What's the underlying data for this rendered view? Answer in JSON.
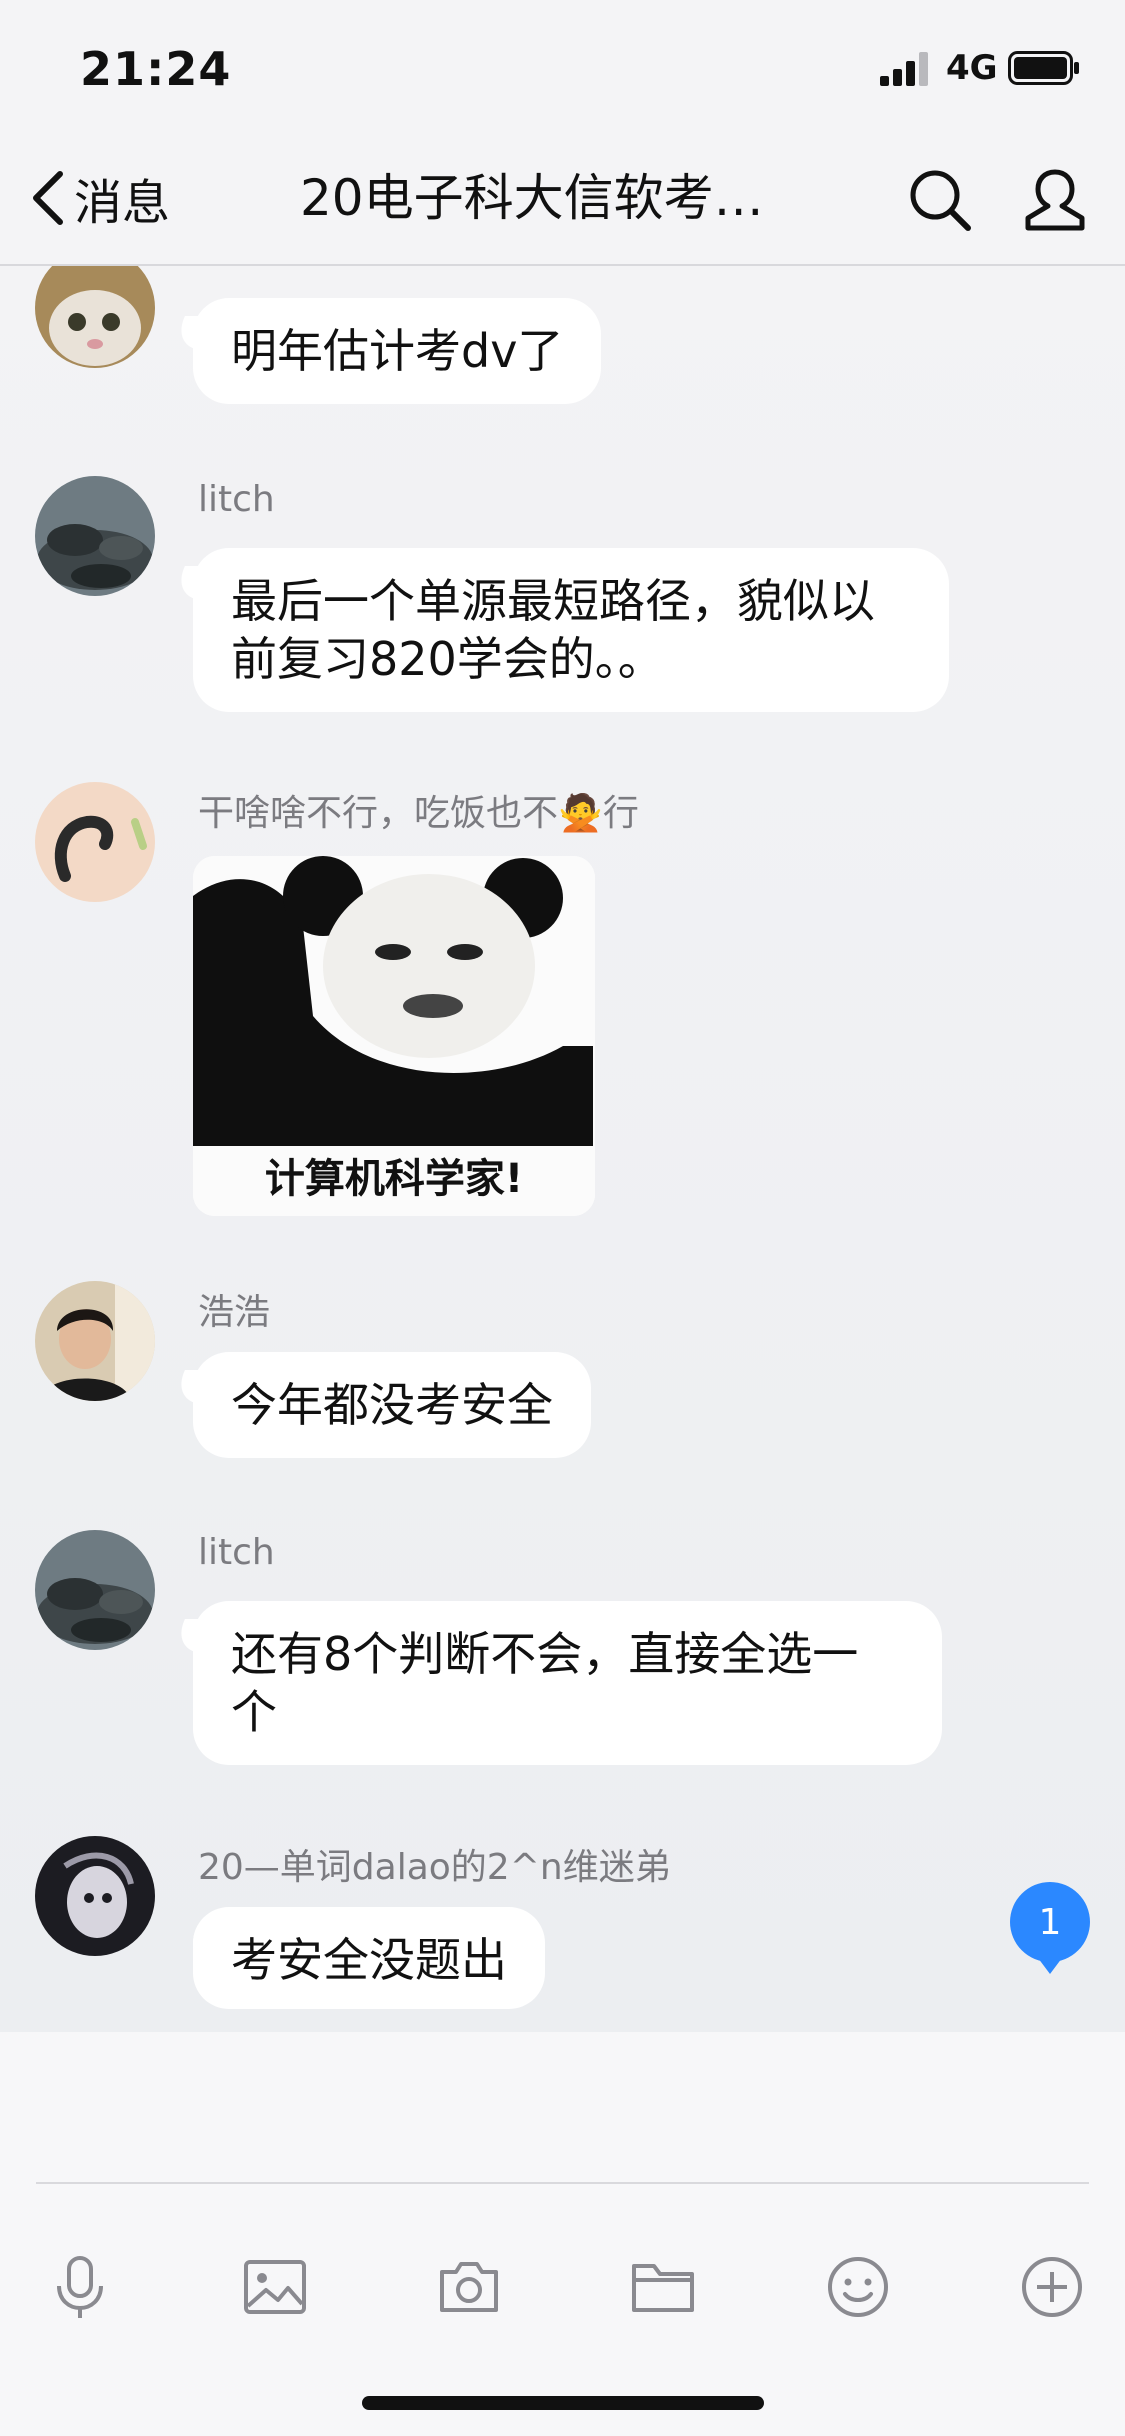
{
  "status_bar": {
    "time": "21:24",
    "network": "4G"
  },
  "nav": {
    "back_label": "消息",
    "title": "20电子科大信软考…"
  },
  "messages": [
    {
      "sender": "",
      "text": "明年估计考dv了"
    },
    {
      "sender": "litch",
      "text": "最后一个单源最短路径，貌似以前复习820学会的。。"
    },
    {
      "sender": "干啥啥不行，吃饭也不🙅行",
      "sticker_caption": "计算机科学家!"
    },
    {
      "sender": "浩浩",
      "text": "今年都没考安全"
    },
    {
      "sender": "litch",
      "text": "还有8个判断不会，直接全选一个"
    },
    {
      "sender": "20—单词dalao的2^n维迷弟",
      "text": "考安全没题出"
    }
  ],
  "unread_count": "1",
  "toolbar": [
    "microphone-icon",
    "image-icon",
    "camera-icon",
    "folder-icon",
    "emoji-icon",
    "plus-icon"
  ],
  "colors": {
    "accent": "#2b88ff",
    "bubble": "#ffffff",
    "background": "#f1f2f5"
  }
}
